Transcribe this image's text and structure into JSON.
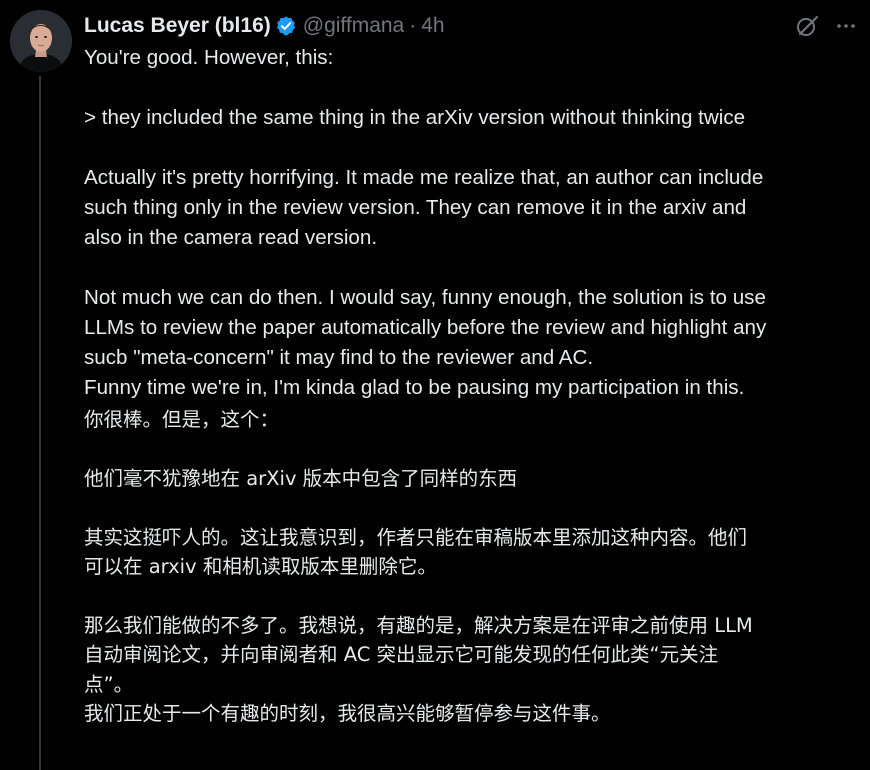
{
  "author": {
    "display_name": "Lucas Beyer (bl16)",
    "handle": "@giffmana",
    "separator": "·",
    "time": "4h",
    "verified": true
  },
  "icons": {
    "verified": "verified-badge-icon",
    "grok": "grok-icon",
    "more": "more-icon",
    "accent_color": "#1d9bf0"
  },
  "tweet": {
    "original": {
      "line_1": "You're good. However, this:",
      "line_2": "> they included the same thing in the arXiv version without thinking twice",
      "line_3a": "Actually it's pretty horrifying. It made me realize that, an author can include",
      "line_3b": "such thing only in the review version. They can remove it in the arxiv and",
      "line_3c": "also in the camera read version.",
      "line_4a": "Not much we can do then. I would say, funny enough, the solution is to use",
      "line_4b": "LLMs to review the paper automatically before the review and highlight any",
      "line_4c": "sucb \"meta-concern\" it may find to the reviewer and AC.",
      "line_5": "Funny time we're in, I'm kinda glad to be pausing my participation in this."
    },
    "translation": {
      "line_1": "你很棒。但是，这个：",
      "line_2": "他们毫不犹豫地在 arXiv 版本中包含了同样的东西",
      "line_3a": "其实这挺吓人的。这让我意识到，作者只能在审稿版本里添加这种内容。他们",
      "line_3b": "可以在 arxiv 和相机读取版本里删除它。",
      "line_4a": "那么我们能做的不多了。我想说，有趣的是，解决方案是在评审之前使用 LLM",
      "line_4b": "自动审阅论文，并向审阅者和 AC 突出显示它可能发现的任何此类“元关注",
      "line_4c": "点”。",
      "line_5": "我们正处于一个有趣的时刻，我很高兴能够暂停参与这件事。"
    }
  }
}
